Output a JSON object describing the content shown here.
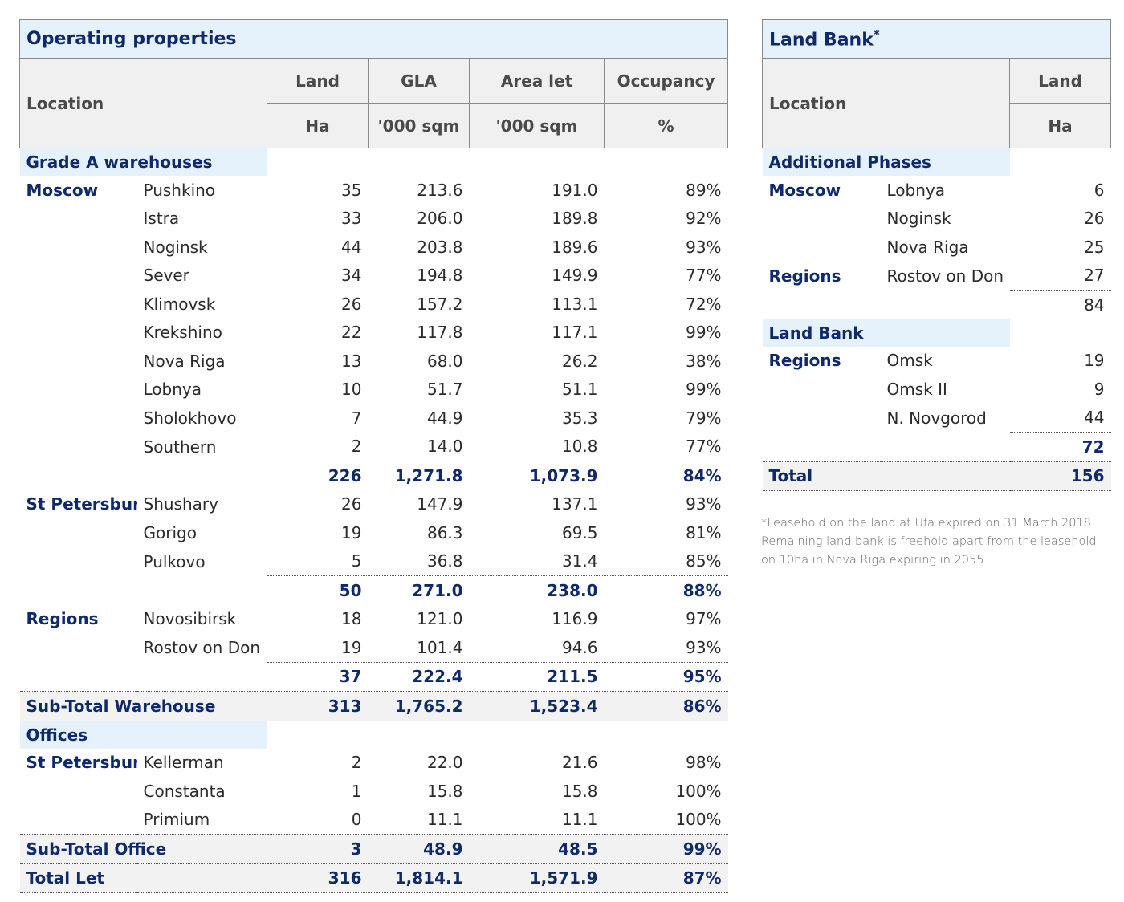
{
  "operating": {
    "title": "Operating properties",
    "headers": {
      "location": "Location",
      "land": "Land",
      "gla": "GLA",
      "area_let": "Area let",
      "occupancy": "Occupancy",
      "land_unit": "Ha",
      "gla_unit": "'000 sqm",
      "area_let_unit": "'000 sqm",
      "occupancy_unit": "%"
    },
    "sections": {
      "warehouses": "Grade A warehouses",
      "offices": "Offices"
    },
    "rows": [
      {
        "region": "Moscow",
        "name": "Pushkino",
        "land": "35",
        "gla": "213.6",
        "let": "191.0",
        "occ": "89%"
      },
      {
        "region": "",
        "name": "Istra",
        "land": "33",
        "gla": "206.0",
        "let": "189.8",
        "occ": "92%"
      },
      {
        "region": "",
        "name": "Noginsk",
        "land": "44",
        "gla": "203.8",
        "let": "189.6",
        "occ": "93%"
      },
      {
        "region": "",
        "name": "Sever",
        "land": "34",
        "gla": "194.8",
        "let": "149.9",
        "occ": "77%"
      },
      {
        "region": "",
        "name": "Klimovsk",
        "land": "26",
        "gla": "157.2",
        "let": "113.1",
        "occ": "72%"
      },
      {
        "region": "",
        "name": "Krekshino",
        "land": "22",
        "gla": "117.8",
        "let": "117.1",
        "occ": "99%"
      },
      {
        "region": "",
        "name": "Nova Riga",
        "land": "13",
        "gla": "68.0",
        "let": "26.2",
        "occ": "38%"
      },
      {
        "region": "",
        "name": "Lobnya",
        "land": "10",
        "gla": "51.7",
        "let": "51.1",
        "occ": "99%"
      },
      {
        "region": "",
        "name": "Sholokhovo",
        "land": "7",
        "gla": "44.9",
        "let": "35.3",
        "occ": "79%"
      },
      {
        "region": "",
        "name": "Southern",
        "land": "2",
        "gla": "14.0",
        "let": "10.8",
        "occ": "77%"
      }
    ],
    "moscow_total": {
      "land": "226",
      "gla": "1,271.8",
      "let": "1,073.9",
      "occ": "84%"
    },
    "stp_rows": [
      {
        "region": "St Petersburg",
        "name": "Shushary",
        "land": "26",
        "gla": "147.9",
        "let": "137.1",
        "occ": "93%"
      },
      {
        "region": "",
        "name": "Gorigo",
        "land": "19",
        "gla": "86.3",
        "let": "69.5",
        "occ": "81%"
      },
      {
        "region": "",
        "name": "Pulkovo",
        "land": "5",
        "gla": "36.8",
        "let": "31.4",
        "occ": "85%"
      }
    ],
    "stp_total": {
      "land": "50",
      "gla": "271.0",
      "let": "238.0",
      "occ": "88%"
    },
    "reg_rows": [
      {
        "region": "Regions",
        "name": "Novosibirsk",
        "land": "18",
        "gla": "121.0",
        "let": "116.9",
        "occ": "97%"
      },
      {
        "region": "",
        "name": "Rostov on Don",
        "land": "19",
        "gla": "101.4",
        "let": "94.6",
        "occ": "93%"
      }
    ],
    "reg_total": {
      "land": "37",
      "gla": "222.4",
      "let": "211.5",
      "occ": "95%"
    },
    "subtotal_warehouse": {
      "label": "Sub-Total Warehouse",
      "land": "313",
      "gla": "1,765.2",
      "let": "1,523.4",
      "occ": "86%"
    },
    "office_rows": [
      {
        "region": "St Petersburg",
        "name": "Kellerman",
        "land": "2",
        "gla": "22.0",
        "let": "21.6",
        "occ": "98%"
      },
      {
        "region": "",
        "name": "Constanta",
        "land": "1",
        "gla": "15.8",
        "let": "15.8",
        "occ": "100%"
      },
      {
        "region": "",
        "name": "Primium",
        "land": "0",
        "gla": "11.1",
        "let": "11.1",
        "occ": "100%"
      }
    ],
    "subtotal_office": {
      "label": "Sub-Total Office",
      "land": "3",
      "gla": "48.9",
      "let": "48.5",
      "occ": "99%"
    },
    "total_let": {
      "label": "Total Let",
      "land": "316",
      "gla": "1,814.1",
      "let": "1,571.9",
      "occ": "87%"
    }
  },
  "landbank": {
    "title": "Land Bank",
    "title_mark": "*",
    "headers": {
      "location": "Location",
      "land": "Land",
      "land_unit": "Ha"
    },
    "sections": {
      "phases": "Additional Phases",
      "landbank": "Land Bank"
    },
    "phase_rows": [
      {
        "region": "Moscow",
        "name": "Lobnya",
        "land": "6"
      },
      {
        "region": "",
        "name": "Noginsk",
        "land": "26"
      },
      {
        "region": "",
        "name": "Nova Riga",
        "land": "25"
      },
      {
        "region": "Regions",
        "name": "Rostov on Don",
        "land": "27"
      }
    ],
    "phase_total": "84",
    "bank_rows": [
      {
        "region": "Regions",
        "name": "Omsk",
        "land": "19"
      },
      {
        "region": "",
        "name": "Omsk II",
        "land": "9"
      },
      {
        "region": "",
        "name": "N. Novgorod",
        "land": "44"
      }
    ],
    "bank_total": "72",
    "total": {
      "label": "Total",
      "land": "156"
    }
  },
  "footnote": "*Leasehold on the land at Ufa expired on 31 March 2018. Remaining land bank is freehold apart from the leasehold on 10ha in Nova Riga expiring in 2055."
}
